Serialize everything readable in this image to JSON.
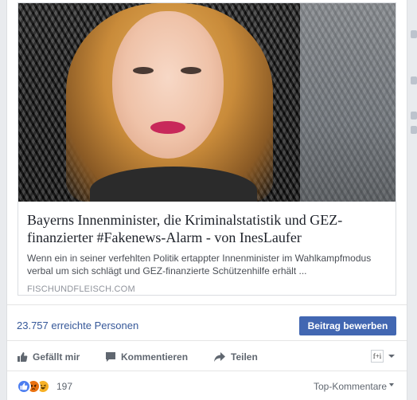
{
  "link": {
    "title": "Bayerns Innenminister, die Kriminalstatistik und GEZ-finanzierter #Fakenews-Alarm - von InesLaufer",
    "description": "Wenn ein in seiner verfehlten Politik ertappter Innenminister im Wahlkampfmodus verbal um sich schlägt und GEZ-finanzierte Schützenhilfe erhält ...",
    "domain": "FISCHUNDFLEISCH.COM"
  },
  "reach": {
    "text": "23.757 erreichte Personen",
    "boost_label": "Beitrag bewerben"
  },
  "actions": {
    "like": "Gefällt mir",
    "comment": "Kommentieren",
    "share": "Teilen"
  },
  "page_avatar_text": "f+i",
  "reactions": {
    "icons": [
      "like",
      "angry",
      "haha"
    ],
    "count": "197",
    "sort_label": "Top-Kommentare"
  },
  "colors": {
    "link_blue": "#365899",
    "button_blue": "#4267b2",
    "gray_text": "#606770"
  }
}
